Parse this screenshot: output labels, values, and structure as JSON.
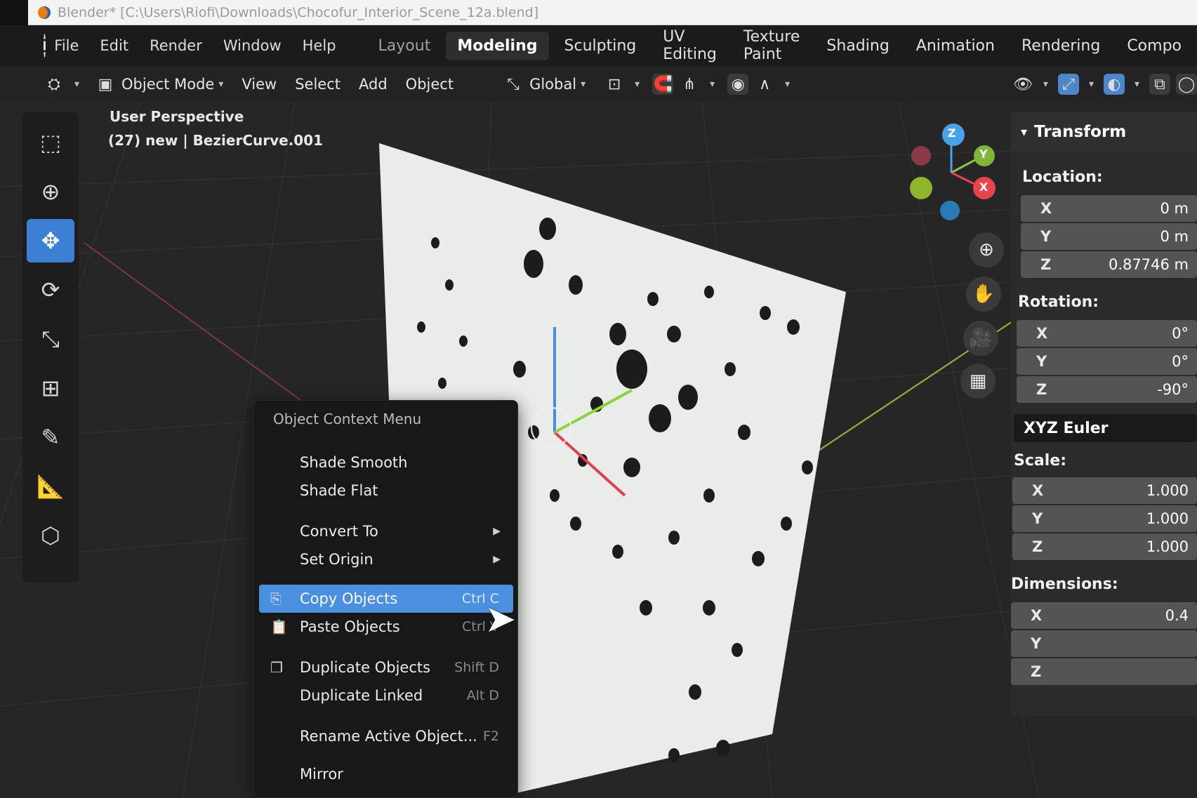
{
  "window": {
    "title": "Blender* [C:\\Users\\Riofi\\Downloads\\Chocofur_Interior_Scene_12a.blend]"
  },
  "menubar": {
    "items": [
      "File",
      "Edit",
      "Render",
      "Window",
      "Help"
    ],
    "workspaces": [
      "Layout",
      "Modeling",
      "Sculpting",
      "UV Editing",
      "Texture Paint",
      "Shading",
      "Animation",
      "Rendering",
      "Compo"
    ],
    "active_workspace": "Modeling"
  },
  "header": {
    "mode": "Object Mode",
    "menus": [
      "View",
      "Select",
      "Add",
      "Object"
    ],
    "orientation": "Global"
  },
  "viewport": {
    "perspective": "User Perspective",
    "object_info": "(27) new | BezierCurve.001",
    "gizmo_axes": [
      "Z",
      "Y",
      "X"
    ]
  },
  "transform_panel": {
    "title": "Transform",
    "location_label": "Location:",
    "location": [
      {
        "axis": "X",
        "value": "0 m"
      },
      {
        "axis": "Y",
        "value": "0 m"
      },
      {
        "axis": "Z",
        "value": "0.87746 m"
      }
    ],
    "rotation_label": "Rotation:",
    "rotation": [
      {
        "axis": "X",
        "value": "0°"
      },
      {
        "axis": "Y",
        "value": "0°"
      },
      {
        "axis": "Z",
        "value": "-90°"
      }
    ],
    "rotation_mode": "XYZ Euler",
    "scale_label": "Scale:",
    "scale": [
      {
        "axis": "X",
        "value": "1.000"
      },
      {
        "axis": "Y",
        "value": "1.000"
      },
      {
        "axis": "Z",
        "value": "1.000"
      }
    ],
    "dimensions_label": "Dimensions:",
    "dimensions": [
      {
        "axis": "X",
        "value": "0.4"
      },
      {
        "axis": "Y",
        "value": ""
      },
      {
        "axis": "Z",
        "value": ""
      }
    ]
  },
  "context_menu": {
    "title": "Object Context Menu",
    "items": [
      {
        "label": "Shade Smooth",
        "shortcut": ""
      },
      {
        "label": "Shade Flat",
        "shortcut": ""
      },
      {
        "label": "Convert To",
        "shortcut": "",
        "submenu": true
      },
      {
        "label": "Set Origin",
        "shortcut": "",
        "submenu": true
      },
      {
        "label": "Copy Objects",
        "shortcut": "Ctrl C",
        "highlighted": true,
        "icon": "copy-icon"
      },
      {
        "label": "Paste Objects",
        "shortcut": "Ctrl V",
        "icon": "paste-icon"
      },
      {
        "label": "Duplicate Objects",
        "shortcut": "Shift D",
        "icon": "duplicate-icon"
      },
      {
        "label": "Duplicate Linked",
        "shortcut": "Alt D"
      },
      {
        "label": "Rename Active Object...",
        "shortcut": "F2"
      },
      {
        "label": "Mirror",
        "shortcut": ""
      }
    ]
  },
  "colors": {
    "accent": "#4b8fe0",
    "axis_x": "#e8434f",
    "axis_y": "#8bc34a",
    "axis_z": "#4aa3e8"
  }
}
